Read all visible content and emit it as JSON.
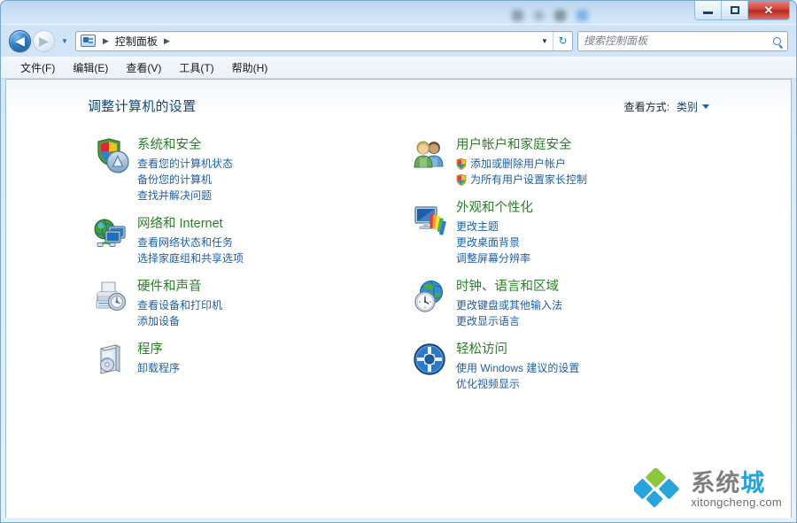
{
  "window": {
    "controls": {
      "minimize": "—",
      "maximize": "▢",
      "close": "✕"
    }
  },
  "nav": {
    "back_glyph": "◀",
    "forward_glyph": "▶",
    "history_glyph": "▼",
    "breadcrumb": {
      "icon": "control-panel-icon",
      "separator_1": "▶",
      "item": "控制面板",
      "separator_2": "▶"
    },
    "dropdown_glyph": "▼",
    "refresh_glyph": "↻"
  },
  "search": {
    "placeholder": "搜索控制面板",
    "value": "",
    "icon": "search-icon"
  },
  "menubar": {
    "items": [
      {
        "label": "文件(F)"
      },
      {
        "label": "编辑(E)"
      },
      {
        "label": "查看(V)"
      },
      {
        "label": "工具(T)"
      },
      {
        "label": "帮助(H)"
      }
    ]
  },
  "main": {
    "page_title": "调整计算机的设置",
    "viewby": {
      "label": "查看方式:",
      "value": "类别"
    },
    "left_column": [
      {
        "icon": "system-security-shield-icon",
        "title": "系统和安全",
        "links": [
          {
            "text": "查看您的计算机状态",
            "shield": false
          },
          {
            "text": "备份您的计算机",
            "shield": false
          },
          {
            "text": "查找并解决问题",
            "shield": false
          }
        ]
      },
      {
        "icon": "network-internet-globe-icon",
        "title": "网络和 Internet",
        "links": [
          {
            "text": "查看网络状态和任务",
            "shield": false
          },
          {
            "text": "选择家庭组和共享选项",
            "shield": false
          }
        ]
      },
      {
        "icon": "hardware-sound-printer-icon",
        "title": "硬件和声音",
        "links": [
          {
            "text": "查看设备和打印机",
            "shield": false
          },
          {
            "text": "添加设备",
            "shield": false
          }
        ]
      },
      {
        "icon": "programs-box-icon",
        "title": "程序",
        "links": [
          {
            "text": "卸载程序",
            "shield": false
          }
        ]
      }
    ],
    "right_column": [
      {
        "icon": "user-accounts-people-icon",
        "title": "用户帐户和家庭安全",
        "links": [
          {
            "text": "添加或删除用户帐户",
            "shield": true
          },
          {
            "text": "为所有用户设置家长控制",
            "shield": true
          }
        ]
      },
      {
        "icon": "appearance-personalization-monitor-icon",
        "title": "外观和个性化",
        "links": [
          {
            "text": "更改主题",
            "shield": false
          },
          {
            "text": "更改桌面背景",
            "shield": false
          },
          {
            "text": "调整屏幕分辨率",
            "shield": false
          }
        ]
      },
      {
        "icon": "clock-language-region-icon",
        "title": "时钟、语言和区域",
        "links": [
          {
            "text": "更改键盘或其他输入法",
            "shield": false
          },
          {
            "text": "更改显示语言",
            "shield": false
          }
        ]
      },
      {
        "icon": "ease-of-access-icon",
        "title": "轻松访问",
        "links": [
          {
            "text": "使用 Windows 建议的设置",
            "shield": false
          },
          {
            "text": "优化视频显示",
            "shield": false
          }
        ]
      }
    ]
  },
  "watermark": {
    "logo": "diamond-cluster-logo",
    "main_part1": "系统",
    "main_part2": "城",
    "sub": "xitongcheng.com"
  },
  "colors": {
    "category_title": "#2b7d2b",
    "link": "#1f5fa8",
    "page_title": "#12477f",
    "close_button": "#cf3f32",
    "watermark_accent": "#29a3dc"
  }
}
